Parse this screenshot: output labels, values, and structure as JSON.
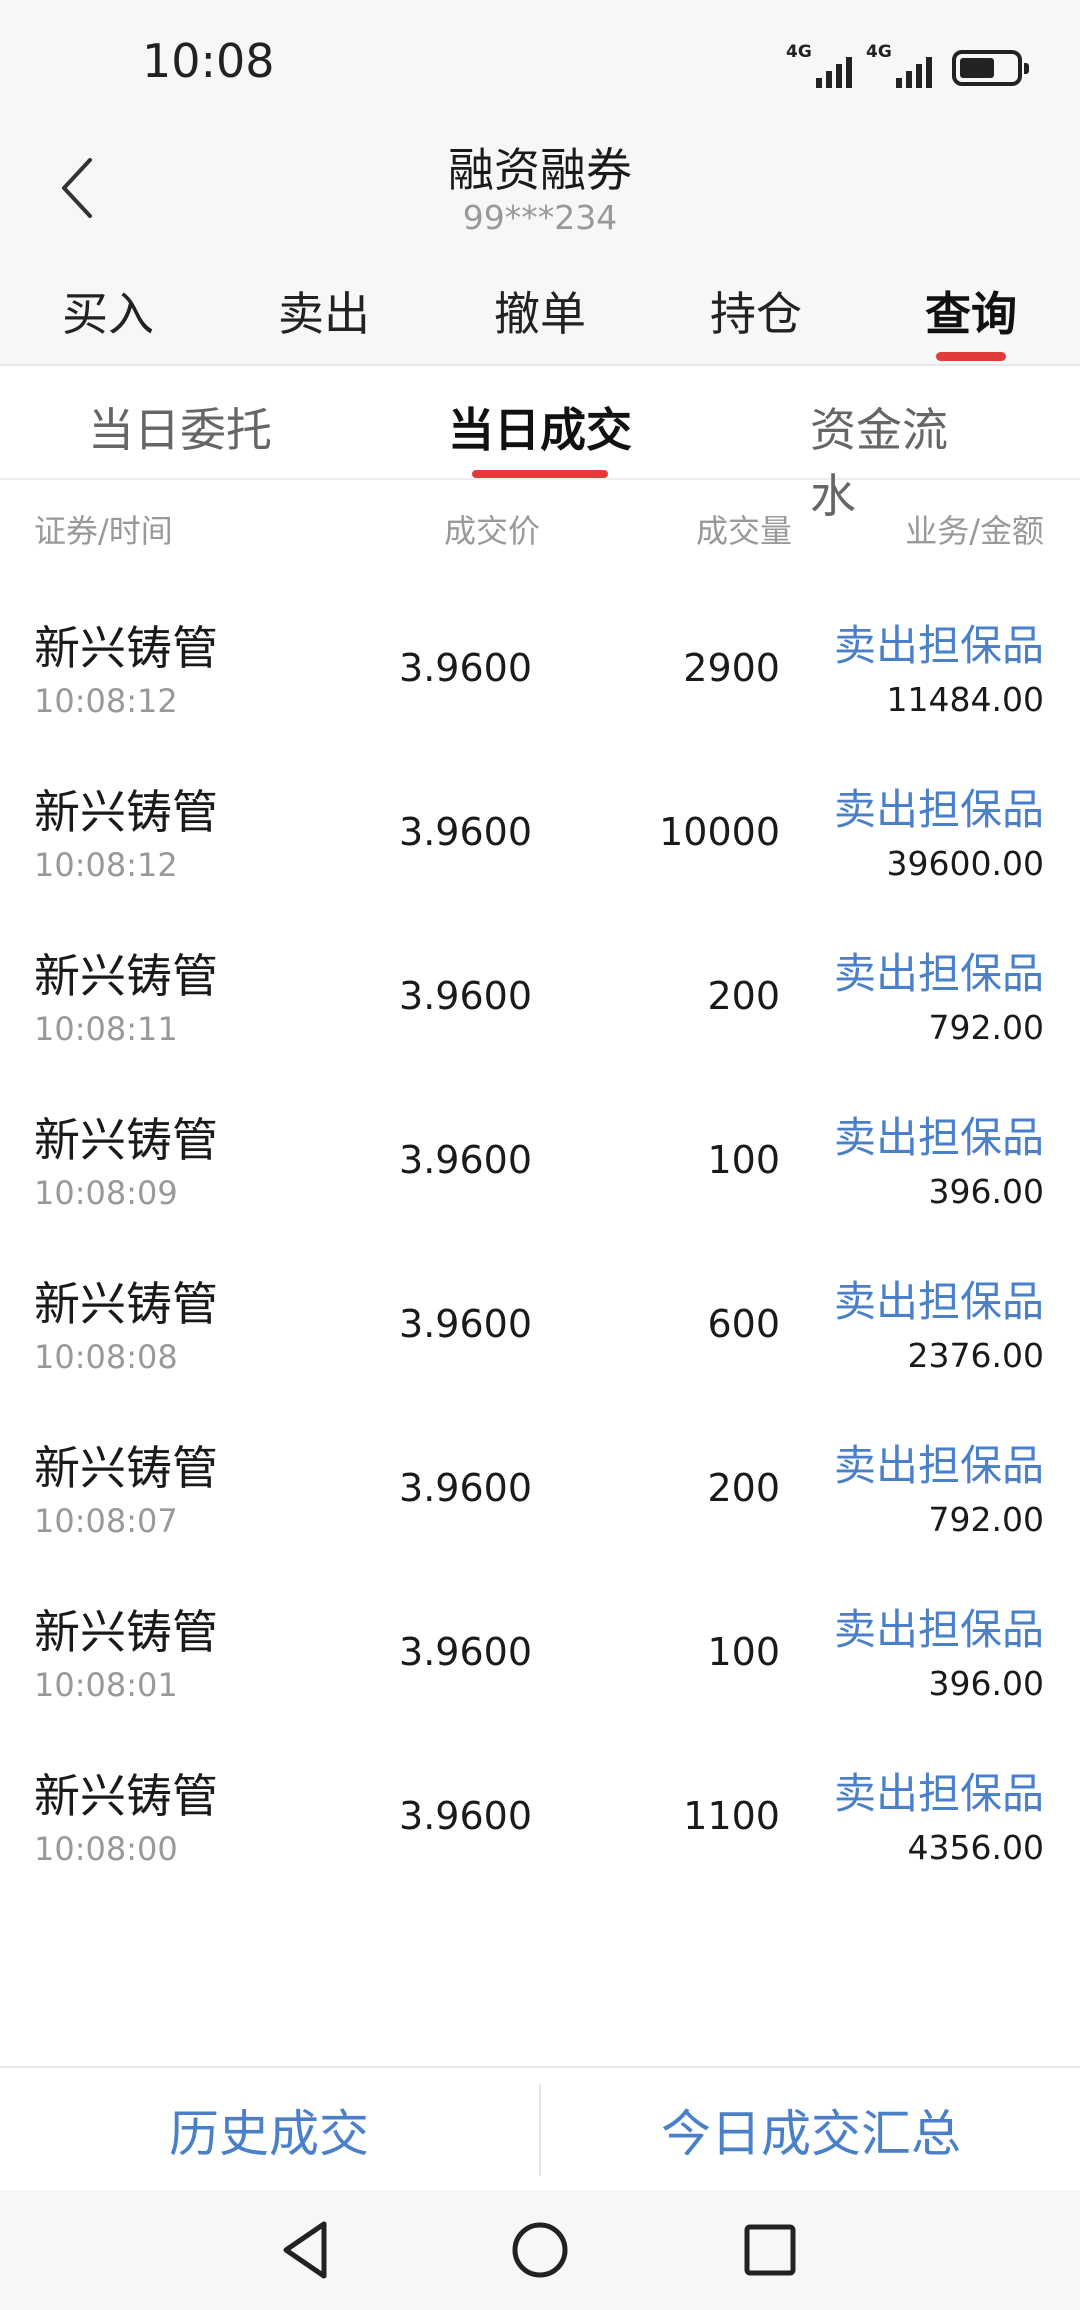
{
  "status_bar": {
    "time": "10:08",
    "network_1": "4G",
    "network_2": "4G"
  },
  "header": {
    "title": "融资融券",
    "account": "99***234"
  },
  "main_tabs": [
    "买入",
    "卖出",
    "撤单",
    "持仓",
    "查询"
  ],
  "main_tab_active": "查询",
  "sub_tabs": [
    "当日委托",
    "当日成交",
    "资金流水"
  ],
  "sub_tab_active": "当日成交",
  "columns": {
    "security_time": "证券/时间",
    "price": "成交价",
    "quantity": "成交量",
    "business_amount": "业务/金额"
  },
  "trades": [
    {
      "name": "新兴铸管",
      "time": "10:08:12",
      "price": "3.9600",
      "quantity": "2900",
      "business": "卖出担保品",
      "amount": "11484.00"
    },
    {
      "name": "新兴铸管",
      "time": "10:08:12",
      "price": "3.9600",
      "quantity": "10000",
      "business": "卖出担保品",
      "amount": "39600.00"
    },
    {
      "name": "新兴铸管",
      "time": "10:08:11",
      "price": "3.9600",
      "quantity": "200",
      "business": "卖出担保品",
      "amount": "792.00"
    },
    {
      "name": "新兴铸管",
      "time": "10:08:09",
      "price": "3.9600",
      "quantity": "100",
      "business": "卖出担保品",
      "amount": "396.00"
    },
    {
      "name": "新兴铸管",
      "time": "10:08:08",
      "price": "3.9600",
      "quantity": "600",
      "business": "卖出担保品",
      "amount": "2376.00"
    },
    {
      "name": "新兴铸管",
      "time": "10:08:07",
      "price": "3.9600",
      "quantity": "200",
      "business": "卖出担保品",
      "amount": "792.00"
    },
    {
      "name": "新兴铸管",
      "time": "10:08:01",
      "price": "3.9600",
      "quantity": "100",
      "business": "卖出担保品",
      "amount": "396.00"
    },
    {
      "name": "新兴铸管",
      "time": "10:08:00",
      "price": "3.9600",
      "quantity": "1100",
      "business": "卖出担保品",
      "amount": "4356.00"
    }
  ],
  "bottom_actions": {
    "history": "历史成交",
    "today_summary": "今日成交汇总"
  },
  "icons": {
    "back": "chevron-left-icon",
    "nav_back": "triangle-back-icon",
    "nav_home": "circle-home-icon",
    "nav_recent": "square-recent-icon"
  },
  "colors": {
    "accent_red": "#e03c3c",
    "link_blue": "#4a7fc9",
    "text_gray": "#999999"
  }
}
